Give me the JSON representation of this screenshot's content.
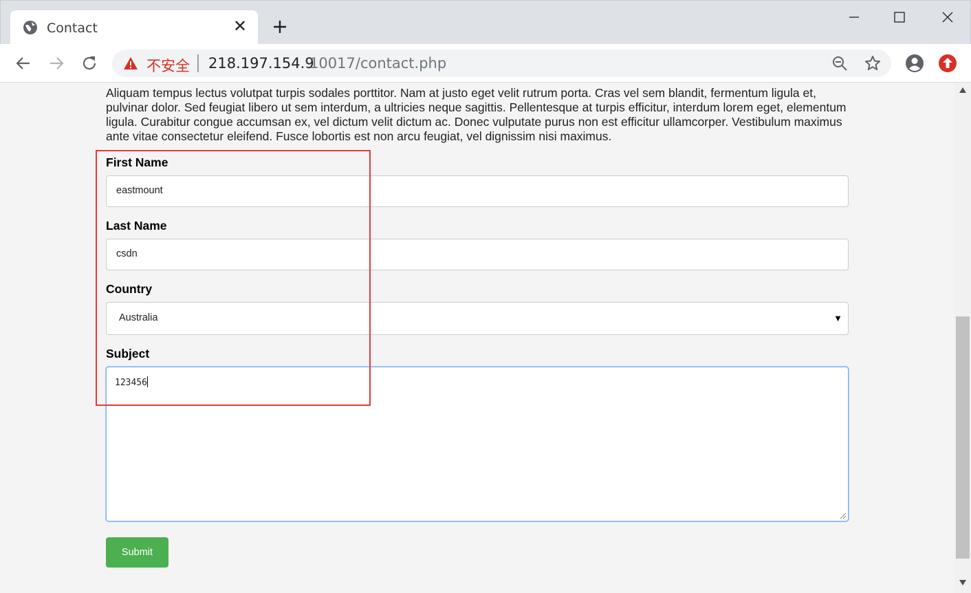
{
  "browser": {
    "tab_title": "Contact",
    "tab_close": "✕",
    "security_label": "不安全",
    "url_host": "218.197.154.9",
    "url_path": ":10017/contact.php"
  },
  "page": {
    "intro": "Aliquam tempus lectus volutpat turpis sodales porttitor. Nam at justo eget velit rutrum porta. Cras vel sem blandit, fermentum ligula et, pulvinar dolor. Sed feugiat libero ut sem interdum, a ultricies neque sagittis. Pellentesque at turpis efficitur, interdum lorem eget, elementum ligula. Curabitur congue accumsan ex, vel dictum velit dictum ac. Donec vulputate purus non est efficitur ullamcorper. Vestibulum maximus ante vitae consectetur eleifend. Fusce lobortis est non arcu feugiat, vel dignissim nisi maximus.",
    "form": {
      "first_name_label": "First Name",
      "first_name_value": "eastmount",
      "last_name_label": "Last Name",
      "last_name_value": "csdn",
      "country_label": "Country",
      "country_value": "Australia",
      "subject_label": "Subject",
      "subject_value": "123456",
      "submit_label": "Submit"
    }
  },
  "colors": {
    "submit": "#4caf50",
    "highlight_box": "#e53935",
    "insecure_text": "#d93025"
  }
}
